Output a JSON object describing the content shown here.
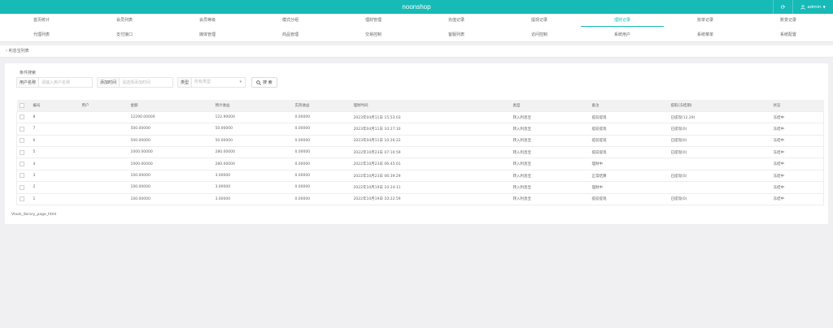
{
  "app": {
    "brand": "noonshop",
    "user": "admin"
  },
  "nav": {
    "row1": [
      "首页统计",
      "会员列表",
      "会员等级",
      "模式分组",
      "理财管理",
      "充值记录",
      "提现记录",
      "理财记录",
      "抢单记录",
      "账变记录"
    ],
    "row2": [
      "代理列表",
      "支付接口",
      "媒体管理",
      "商品管理",
      "交易控制",
      "客服列表",
      "访问控制",
      "系统用户",
      "系统菜单",
      "系统配置"
    ],
    "active": "理财记录"
  },
  "breadcrumb": "利息宝列表",
  "search": {
    "section_title": "条件搜索",
    "username_label": "用户名称",
    "username_placeholder": "请输入用户名称",
    "date_label": "添加时间",
    "date_placeholder": "请选择添加时间",
    "type_label": "类型",
    "type_placeholder": "所有类型",
    "button_label": "搜 索"
  },
  "table": {
    "columns": [
      "编号",
      "用户",
      "金额",
      "预计收益",
      "实际收益",
      "理财时间",
      "类型",
      "备注",
      "提取(冻结期)",
      "状态"
    ],
    "rows": [
      [
        "8",
        "",
        "12290.00000",
        "122.90000",
        "0.00000",
        "2023年04月11日 15:53:03",
        "转入利息宝",
        "提前提现",
        "已提现(12.29)",
        "冻结中"
      ],
      [
        "7",
        "",
        "500.00000",
        "50.00000",
        "0.00000",
        "2023年04月11日 10:27:10",
        "转入利息宝",
        "提前提现",
        "已提现(0)",
        "冻结中"
      ],
      [
        "6",
        "",
        "500.00000",
        "50.00000",
        "0.00000",
        "2023年04月11日 10:26:22",
        "转入利息宝",
        "提前提现",
        "已提现(0)",
        "冻结中"
      ],
      [
        "5",
        "",
        "1000.00000",
        "280.00000",
        "0.00000",
        "2022年10月23日 07:10:59",
        "转入利息宝",
        "提前提现",
        "已提现(0)",
        "冻结中"
      ],
      [
        "4",
        "",
        "1000.00000",
        "280.00000",
        "0.00000",
        "2022年10月23日 06:45:01",
        "转入利息宝",
        "理财中",
        "",
        "冻结中"
      ],
      [
        "3",
        "",
        "100.00000",
        "3.00000",
        "0.00000",
        "2022年10月23日 06:39:29",
        "转入利息宝",
        "正常结算",
        "已提现(0)",
        "冻结中"
      ],
      [
        "2",
        "",
        "100.00000",
        "3.00000",
        "0.00000",
        "2022年10月19日 10:24:11",
        "转入利息宝",
        "理财中",
        "",
        "冻结中"
      ],
      [
        "1",
        "",
        "100.00000",
        "3.00000",
        "0.00000",
        "2022年10月19日 10:22:59",
        "转入利息宝",
        "提前提现",
        "已提现(0)",
        "冻结中"
      ]
    ]
  },
  "footer_note": "Vtask_library_page_html"
}
